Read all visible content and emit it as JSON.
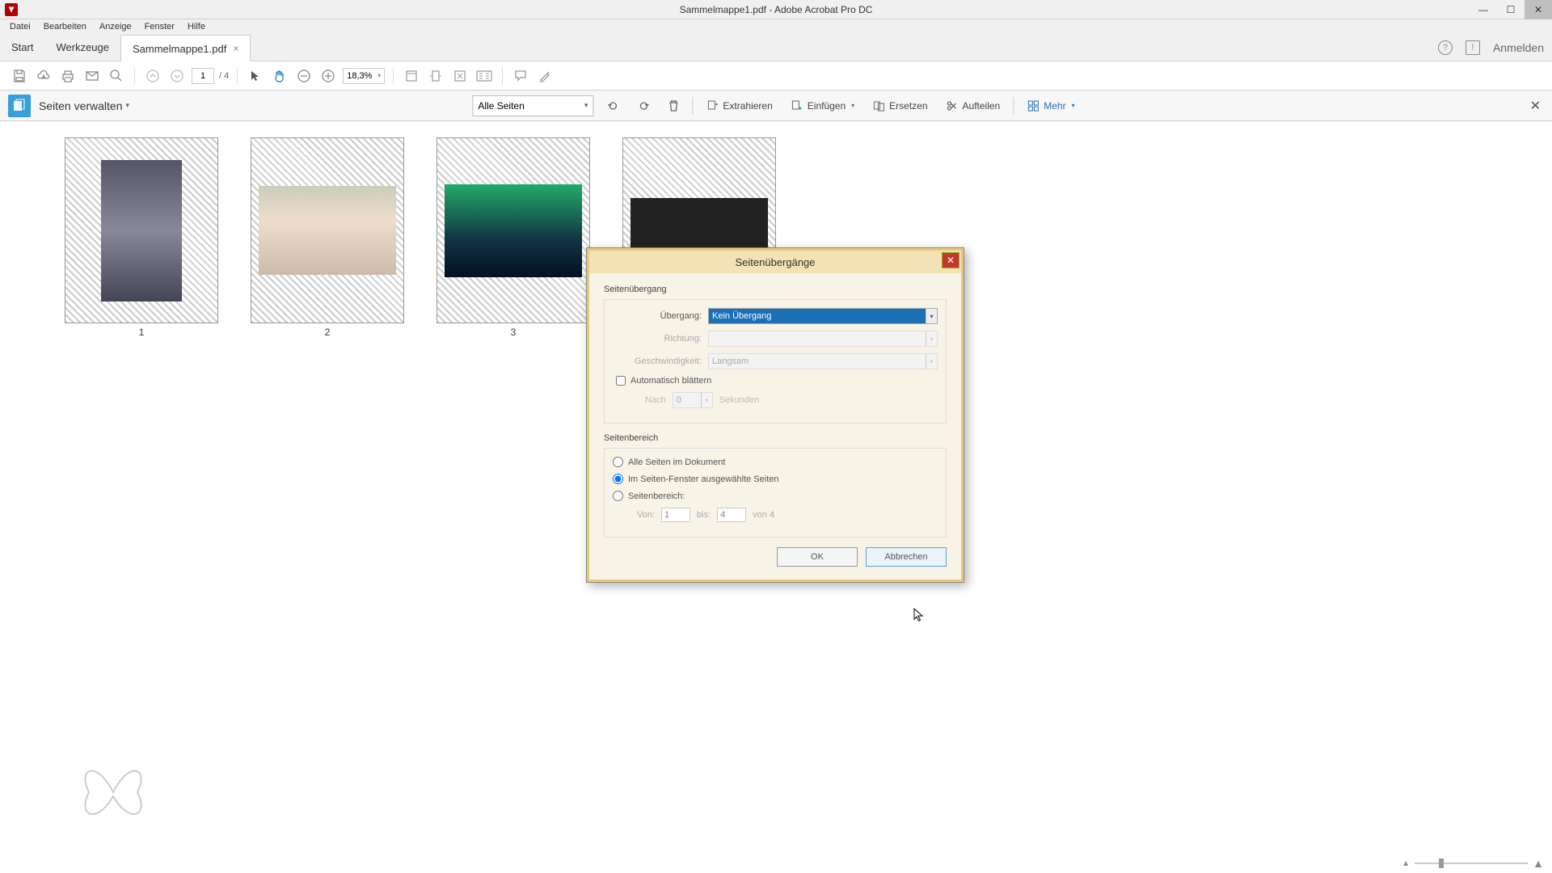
{
  "window": {
    "title": "Sammelmappe1.pdf - Adobe Acrobat Pro DC"
  },
  "menu": {
    "file": "Datei",
    "edit": "Bearbeiten",
    "view": "Anzeige",
    "window": "Fenster",
    "help": "Hilfe"
  },
  "tabs": {
    "start": "Start",
    "tools": "Werkzeuge",
    "doc": "Sammelmappe1.pdf",
    "login": "Anmelden"
  },
  "toolbar": {
    "page_current": "1",
    "page_total": "/ 4",
    "zoom": "18,3%"
  },
  "pagemgmt": {
    "title": "Seiten verwalten",
    "dropdown": "Alle Seiten",
    "extract": "Extrahieren",
    "insert": "Einfügen",
    "replace": "Ersetzen",
    "split": "Aufteilen",
    "more": "Mehr"
  },
  "thumbs": {
    "n1": "1",
    "n2": "2",
    "n3": "3"
  },
  "dialog": {
    "title": "Seitenübergänge",
    "group_transition": "Seitenübergang",
    "lbl_transition": "Übergang:",
    "val_transition": "Kein Übergang",
    "lbl_direction": "Richtung:",
    "lbl_speed": "Geschwindigkeit:",
    "val_speed": "Langsam",
    "chk_autoflip": "Automatisch blättern",
    "lbl_after": "Nach",
    "val_after": "0",
    "lbl_seconds": "Sekunden",
    "group_range": "Seitenbereich",
    "radio_all": "Alle Seiten im Dokument",
    "radio_selected": "Im Seiten-Fenster ausgewählte Seiten",
    "radio_range": "Seitenbereich:",
    "lbl_from": "Von:",
    "val_from": "1",
    "lbl_to": "bis:",
    "val_to": "4",
    "lbl_total": "von 4",
    "ok": "OK",
    "cancel": "Abbrechen"
  }
}
